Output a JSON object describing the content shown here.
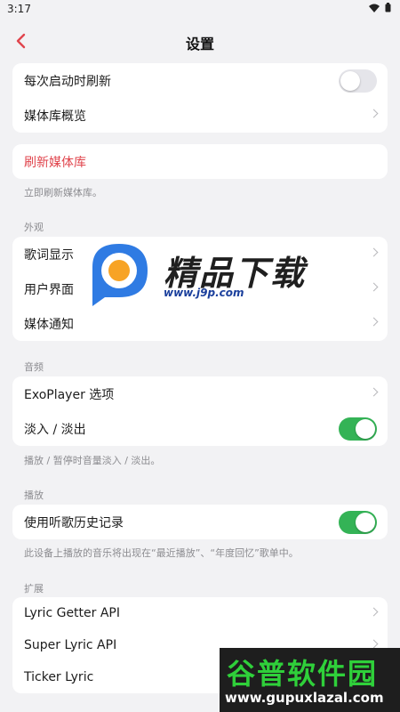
{
  "status_bar": {
    "time": "3:17",
    "icons": [
      "wifi-icon",
      "battery-icon"
    ]
  },
  "header": {
    "title": "设置",
    "back_icon": "chevron-left-icon"
  },
  "general": {
    "refresh_on_start": {
      "label": "每次启动时刷新",
      "enabled": false
    },
    "library_overview": {
      "label": "媒体库概览"
    }
  },
  "refresh": {
    "label": "刷新媒体库",
    "note": "立即刷新媒体库。"
  },
  "appearance": {
    "section_title": "外观",
    "items": [
      {
        "label": "歌词显示"
      },
      {
        "label": "用户界面"
      },
      {
        "label": "媒体通知"
      }
    ]
  },
  "audio": {
    "section_title": "音频",
    "exoplayer": {
      "label": "ExoPlayer 选项"
    },
    "fade": {
      "label": "淡入 / 淡出",
      "enabled": true
    },
    "note": "播放 / 暂停时音量淡入 / 淡出。"
  },
  "playback": {
    "section_title": "播放",
    "history": {
      "label": "使用听歌历史记录",
      "enabled": true
    },
    "note": "此设备上播放的音乐将出现在“最近播放”、“年度回忆”歌单中。"
  },
  "extensions": {
    "section_title": "扩展",
    "items": [
      {
        "label": "Lyric Getter API"
      },
      {
        "label": "Super Lyric API"
      },
      {
        "label": "Ticker Lyric"
      }
    ]
  },
  "watermark": {
    "title": "精品下载",
    "url": "www.j9p.com"
  },
  "stamp": {
    "title": "谷普软件园",
    "url": "www.gupuxlazal.com"
  },
  "colors": {
    "accent_red": "#e0454d",
    "toggle_on": "#34b356",
    "toggle_off": "#e5e5ea",
    "background": "#f2f2f4"
  }
}
